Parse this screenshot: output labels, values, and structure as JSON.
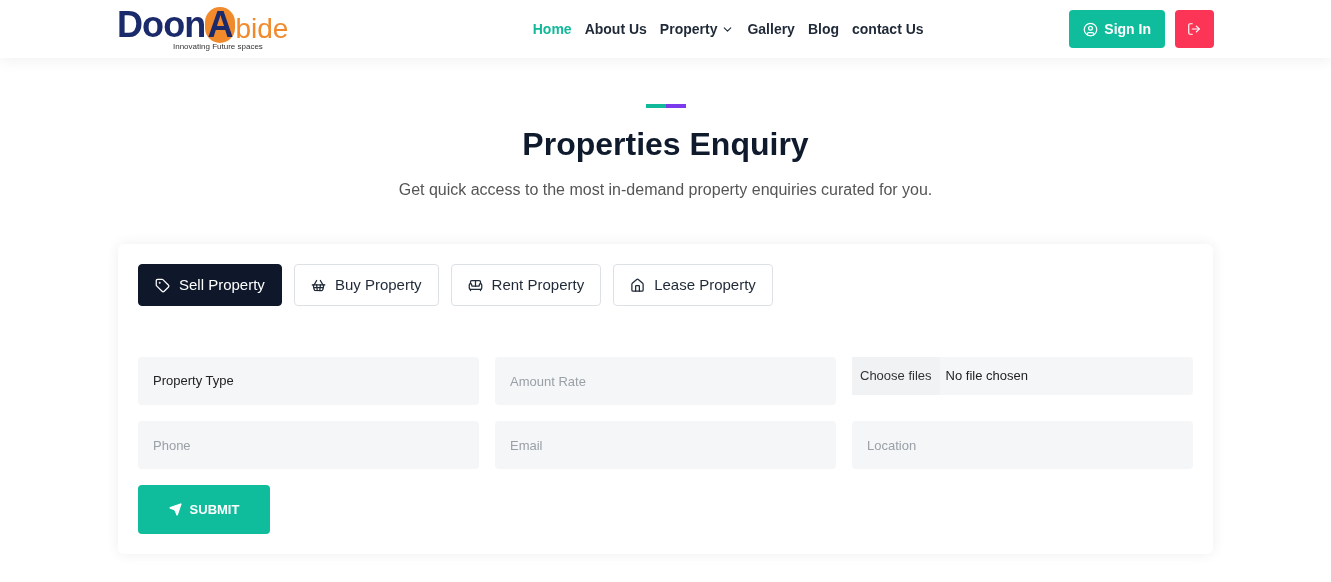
{
  "logo": {
    "first": "Doon",
    "mark": "A",
    "last": "bide",
    "tagline": "Innovating Future spaces"
  },
  "nav": [
    {
      "label": "Home",
      "selected": true,
      "dropdown": false
    },
    {
      "label": "About Us",
      "selected": false,
      "dropdown": false
    },
    {
      "label": "Property",
      "selected": false,
      "dropdown": true
    },
    {
      "label": "Gallery",
      "selected": false,
      "dropdown": false
    },
    {
      "label": "Blog",
      "selected": false,
      "dropdown": false
    },
    {
      "label": "contact Us",
      "selected": false,
      "dropdown": false
    }
  ],
  "sign_in": "Sign In",
  "heading": "Properties Enquiry",
  "subheading": "Get quick access to the most in-demand property enquiries curated for you.",
  "tabs": [
    {
      "label": "Sell Property",
      "selected": true
    },
    {
      "label": "Buy Property",
      "selected": false
    },
    {
      "label": "Rent Property",
      "selected": false
    },
    {
      "label": "Lease Property",
      "selected": false
    }
  ],
  "fields": [
    {
      "kind": "select",
      "value": "Property Type"
    },
    {
      "kind": "text",
      "placeholder": "Amount Rate"
    },
    {
      "kind": "file",
      "button": "Choose files",
      "status": "No file chosen"
    },
    {
      "kind": "text",
      "placeholder": "Phone"
    },
    {
      "kind": "text",
      "placeholder": "Email"
    },
    {
      "kind": "text",
      "placeholder": "Location"
    }
  ],
  "submit": "SUBMIT"
}
